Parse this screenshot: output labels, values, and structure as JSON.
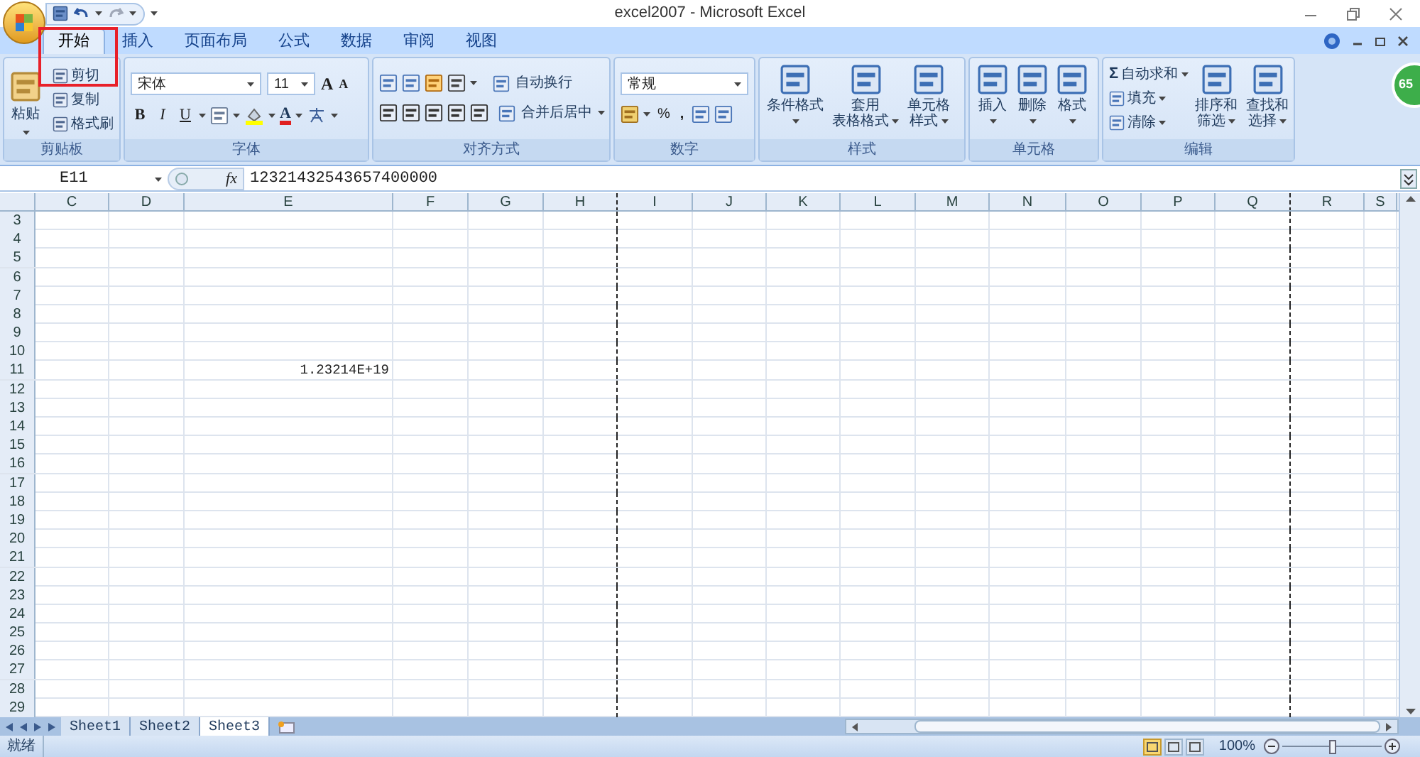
{
  "window": {
    "title": "excel2007 - Microsoft Excel"
  },
  "tabs": [
    {
      "label": "开始",
      "selected": true
    },
    {
      "label": "插入",
      "selected": false
    },
    {
      "label": "页面布局",
      "selected": false
    },
    {
      "label": "公式",
      "selected": false
    },
    {
      "label": "数据",
      "selected": false
    },
    {
      "label": "审阅",
      "selected": false
    },
    {
      "label": "视图",
      "selected": false
    }
  ],
  "highlight_box": true,
  "floating_badge": {
    "text": "65"
  },
  "ribbon": {
    "clipboard": {
      "paste": "粘贴",
      "items": [
        "剪切",
        "复制",
        "格式刷"
      ],
      "label": "剪贴板"
    },
    "font": {
      "font_name": "宋体",
      "font_size": "11",
      "grow": "A",
      "shrink": "A",
      "bold": "B",
      "italic": "I",
      "underline": "U",
      "font_color": "A",
      "label": "字体"
    },
    "alignment": {
      "wrap": "自动换行",
      "merge": "合并后居中",
      "label": "对齐方式"
    },
    "number": {
      "format": "常规",
      "percent": "%",
      "comma": ",",
      "label": "数字"
    },
    "styles": {
      "buttons": [
        {
          "lines": [
            "条件格式"
          ]
        },
        {
          "lines": [
            "套用",
            "表格格式"
          ]
        },
        {
          "lines": [
            "单元格",
            "样式"
          ]
        }
      ],
      "label": "样式"
    },
    "cells": {
      "buttons": [
        "插入",
        "删除",
        "格式"
      ],
      "label": "单元格"
    },
    "editing": {
      "sum_sign": "Σ",
      "items": [
        "自动求和",
        "填充",
        "清除"
      ],
      "buttons": [
        {
          "lines": [
            "排序和",
            "筛选"
          ]
        },
        {
          "lines": [
            "查找和",
            "选择"
          ]
        }
      ],
      "label": "编辑"
    }
  },
  "formula_bar": {
    "name_box": "E11",
    "fx": "fx",
    "formula": "12321432543657400000"
  },
  "columns": [
    {
      "label": "C",
      "page_break_after": false
    },
    {
      "label": "D",
      "page_break_after": false
    },
    {
      "label": "E",
      "page_break_after": false
    },
    {
      "label": "F",
      "page_break_after": false
    },
    {
      "label": "G",
      "page_break_after": false
    },
    {
      "label": "H",
      "page_break_after": true
    },
    {
      "label": "I",
      "page_break_after": false
    },
    {
      "label": "J",
      "page_break_after": false
    },
    {
      "label": "K",
      "page_break_after": false
    },
    {
      "label": "L",
      "page_break_after": false
    },
    {
      "label": "M",
      "page_break_after": false
    },
    {
      "label": "N",
      "page_break_after": false
    },
    {
      "label": "O",
      "page_break_after": false
    },
    {
      "label": "P",
      "page_break_after": false
    },
    {
      "label": "Q",
      "page_break_after": true
    },
    {
      "label": "R",
      "page_break_after": false
    },
    {
      "label": "S",
      "page_break_after": false
    }
  ],
  "rows": [
    {
      "number": "3"
    },
    {
      "number": "4"
    },
    {
      "number": "5"
    },
    {
      "number": "6"
    },
    {
      "number": "7"
    },
    {
      "number": "8"
    },
    {
      "number": "9"
    },
    {
      "number": "10"
    },
    {
      "number": "11",
      "cells": [
        null,
        null,
        "1.23214E+19"
      ]
    },
    {
      "number": "12"
    },
    {
      "number": "13"
    },
    {
      "number": "14"
    },
    {
      "number": "15"
    },
    {
      "number": "16"
    },
    {
      "number": "17"
    },
    {
      "number": "18"
    },
    {
      "number": "19"
    },
    {
      "number": "20"
    },
    {
      "number": "21"
    },
    {
      "number": "22"
    },
    {
      "number": "23"
    },
    {
      "number": "24"
    },
    {
      "number": "25"
    },
    {
      "number": "26"
    },
    {
      "number": "27"
    },
    {
      "number": "28"
    },
    {
      "number": "29"
    }
  ],
  "sheets": [
    {
      "label": "Sheet1",
      "selected": false
    },
    {
      "label": "Sheet2",
      "selected": false
    },
    {
      "label": "Sheet3",
      "selected": true
    }
  ],
  "status_bar": {
    "text": "就绪",
    "view_modes": [
      {
        "selected": true
      },
      {
        "selected": false
      },
      {
        "selected": false
      }
    ],
    "zoom": "100%",
    "level": 0.5
  }
}
